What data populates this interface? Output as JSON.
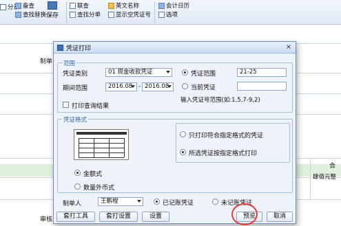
{
  "toolbar": {
    "audit": "备查",
    "find_replace": "查找替换",
    "category": "分录",
    "save": "保存",
    "link_query": "联查",
    "find_voucher": "查找分单",
    "english_name": "英文名称",
    "show_empty": "显示空凭证号",
    "accounting_calendar": "会计日历",
    "options": "选项"
  },
  "background": {
    "maker_label": "制单",
    "auditor_label": "审核",
    "combine_label": "合",
    "amount_text": "肆佰元整"
  },
  "dialog": {
    "title": "凭证打印",
    "close_glyph": "×",
    "range_group": "范围",
    "voucher_type_label": "凭证类别",
    "voucher_type_value": "01 现金收款凭证",
    "period_label": "期间范围",
    "period_from": "2016.08",
    "period_sep": "-",
    "period_to": "2016.08",
    "voucher_range_label": "凭证范围",
    "voucher_range_value": "21-25",
    "current_voucher_label": "当前凭证",
    "current_voucher_value": "",
    "range_hint": "输入凭证号范围(如:1,5,7-9,2)",
    "print_query_label": "打印查询结果",
    "format_group": "凭证格式",
    "only_format_label": "只打印符合指定格式的凭证",
    "all_format_label": "所选凭证按指定格式打印",
    "amount_style_label": "金额式",
    "foreign_style_label": "数量外币式",
    "maker_label": "制单人",
    "maker_value": "王鹏程",
    "posted_label": "已记账凭证",
    "unposted_label": "未记账凭证",
    "buttons": {
      "template": "套打工具",
      "template_settings": "套打设置",
      "settings": "设置",
      "preview": "预览",
      "cancel": "取消"
    }
  },
  "colors": {
    "accent": "#2f63a8",
    "highlight_circle": "#e23b3b"
  }
}
